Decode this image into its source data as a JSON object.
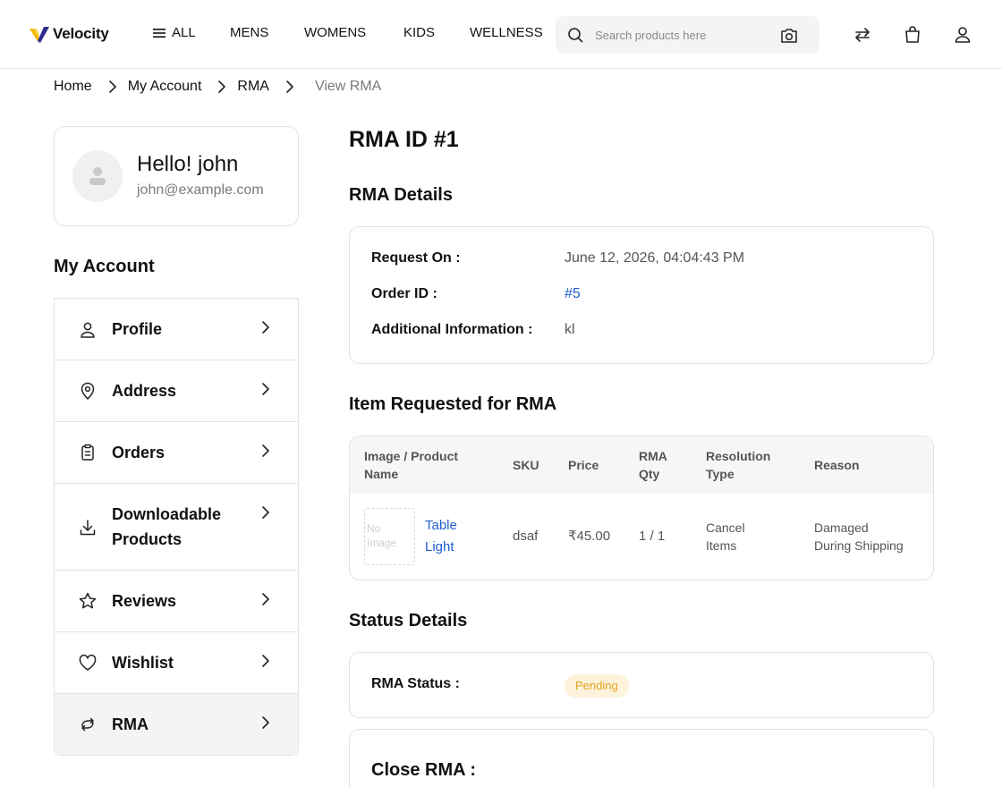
{
  "brand": {
    "name": "Velocity"
  },
  "nav": {
    "all": "ALL",
    "items": [
      "MENS",
      "WOMENS",
      "KIDS",
      "WELLNESS"
    ]
  },
  "search": {
    "placeholder": "Search products here"
  },
  "icons": {
    "logo": "velocity-v-logo",
    "menu": "hamburger-icon",
    "search": "search-icon",
    "camera": "camera-icon",
    "compare": "compare-arrows-icon",
    "cart": "shopping-bag-icon",
    "account": "user-icon"
  },
  "breadcrumb": [
    "Home",
    "My Account",
    "RMA",
    "View RMA"
  ],
  "profile": {
    "greeting": "Hello! john",
    "email": "john@example.com"
  },
  "sidebar": {
    "heading": "My Account",
    "items": [
      {
        "label": "Profile",
        "icon": "user-icon"
      },
      {
        "label": "Address",
        "icon": "map-pin-icon"
      },
      {
        "label": "Orders",
        "icon": "clipboard-icon"
      },
      {
        "label": "Downloadable Products",
        "icon": "download-icon"
      },
      {
        "label": "Reviews",
        "icon": "star-icon"
      },
      {
        "label": "Wishlist",
        "icon": "heart-icon"
      },
      {
        "label": "RMA",
        "icon": "exchange-arrows-icon",
        "active": true
      }
    ]
  },
  "rma": {
    "title": "RMA ID #1",
    "details_heading": "RMA Details",
    "details": {
      "request_on_label": "Request On :",
      "request_on_value": "June 12, 2026, 04:04:43 PM",
      "order_id_label": "Order ID :",
      "order_id_value": "#5",
      "additional_label": "Additional Information :",
      "additional_value": "kl"
    },
    "items_heading": "Item Requested for RMA",
    "table": {
      "headers": {
        "image_product_1": "Image / Product",
        "image_product_2": "Name",
        "sku": "SKU",
        "price": "Price",
        "qty_1": "RMA",
        "qty_2": "Qty",
        "resolution_1": "Resolution",
        "resolution_2": "Type",
        "reason": "Reason"
      },
      "rows": [
        {
          "image_placeholder": "No Image",
          "product_name": "Table Light",
          "sku": "dsaf",
          "price": "₹45.00",
          "rma_qty": "1 / 1",
          "resolution_1": "Cancel",
          "resolution_2": "Items",
          "reason_1": "Damaged",
          "reason_2": "During Shipping"
        }
      ]
    },
    "status_heading": "Status Details",
    "status_label": "RMA Status :",
    "status_value": "Pending",
    "close_heading": "Close RMA :"
  },
  "colors": {
    "link": "#1f5fd1",
    "pending_bg": "#fdf3dc",
    "pending_text": "#e0a320",
    "logo_yellow": "#f5b400"
  }
}
